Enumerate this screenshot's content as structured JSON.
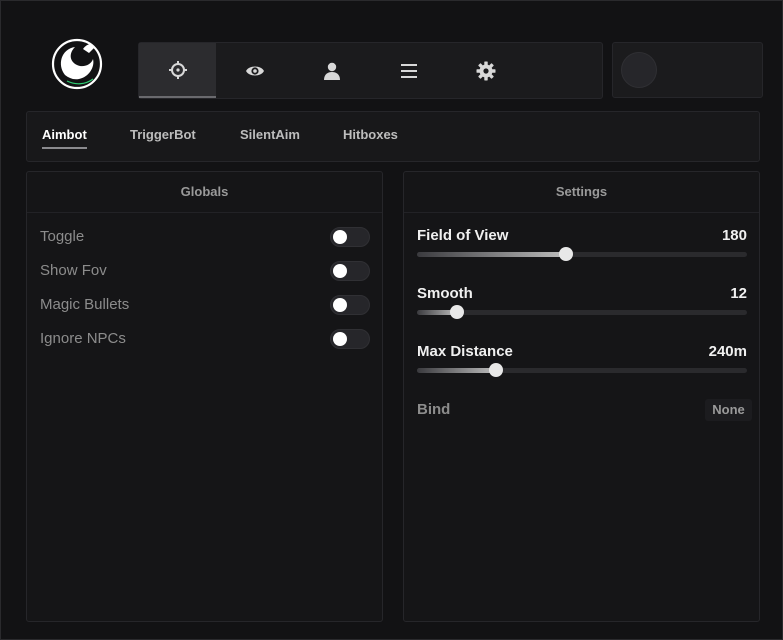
{
  "nav": {
    "tabs": [
      {
        "icon": "crosshair-icon",
        "active": true
      },
      {
        "icon": "eye-icon",
        "active": false
      },
      {
        "icon": "user-icon",
        "active": false
      },
      {
        "icon": "list-icon",
        "active": false
      },
      {
        "icon": "gear-icon",
        "active": false
      }
    ]
  },
  "subtabs": [
    {
      "label": "Aimbot",
      "active": true
    },
    {
      "label": "TriggerBot",
      "active": false
    },
    {
      "label": "SilentAim",
      "active": false
    },
    {
      "label": "Hitboxes",
      "active": false
    }
  ],
  "globals": {
    "title": "Globals",
    "options": [
      {
        "label": "Toggle",
        "enabled": false
      },
      {
        "label": "Show Fov",
        "enabled": false
      },
      {
        "label": "Magic Bullets",
        "enabled": false
      },
      {
        "label": "Ignore NPCs",
        "enabled": false
      }
    ]
  },
  "settings": {
    "title": "Settings",
    "sliders": [
      {
        "label": "Field of View",
        "value": "180",
        "fraction": 0.45
      },
      {
        "label": "Smooth",
        "value": "12",
        "fraction": 0.12
      },
      {
        "label": "Max Distance",
        "value": "240m",
        "fraction": 0.24
      }
    ],
    "bind_label": "Bind",
    "bind_value": "None"
  },
  "colors": {
    "background": "#121214",
    "panel": "#151517",
    "accent": "#e8e8e8"
  }
}
